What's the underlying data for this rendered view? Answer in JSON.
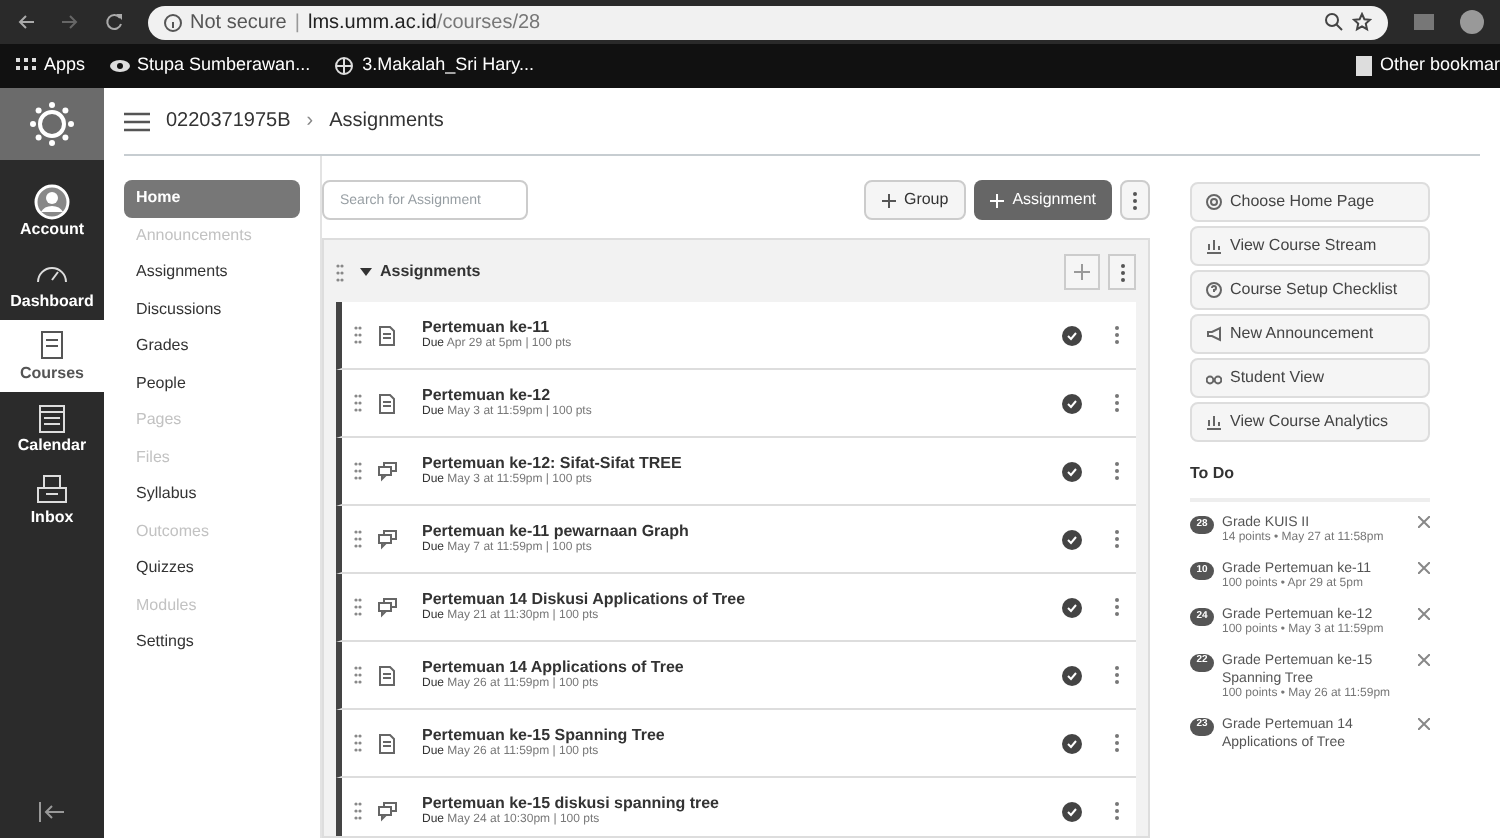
{
  "browser": {
    "security": "Not secure",
    "divider": "|",
    "url_host": "lms.umm.ac.id",
    "url_path": "/courses/28",
    "bookmarks": [
      {
        "label": "Apps",
        "kind": "apps"
      },
      {
        "label": "Stupa Sumberawan...",
        "kind": "eye"
      },
      {
        "label": "3.Makalah_Sri Hary...",
        "kind": "globe"
      }
    ],
    "other_bookmarks": "Other bookmar"
  },
  "global_nav": [
    {
      "label": "Account",
      "kind": "account",
      "selected": false
    },
    {
      "label": "Dashboard",
      "kind": "dashboard",
      "selected": false
    },
    {
      "label": "Courses",
      "kind": "courses",
      "selected": true
    },
    {
      "label": "Calendar",
      "kind": "calendar",
      "selected": false
    },
    {
      "label": "Inbox",
      "kind": "inbox",
      "selected": false
    }
  ],
  "breadcrumb": [
    "0220371975B",
    "Assignments"
  ],
  "breadcrumb_separator": "›",
  "course_nav": [
    {
      "label": "Home",
      "selected": true,
      "disabled": false
    },
    {
      "label": "Announcements",
      "selected": false,
      "disabled": true
    },
    {
      "label": "Assignments",
      "selected": false,
      "disabled": false
    },
    {
      "label": "Discussions",
      "selected": false,
      "disabled": false
    },
    {
      "label": "Grades",
      "selected": false,
      "disabled": false
    },
    {
      "label": "People",
      "selected": false,
      "disabled": false
    },
    {
      "label": "Pages",
      "selected": false,
      "disabled": true
    },
    {
      "label": "Files",
      "selected": false,
      "disabled": true
    },
    {
      "label": "Syllabus",
      "selected": false,
      "disabled": false
    },
    {
      "label": "Outcomes",
      "selected": false,
      "disabled": true
    },
    {
      "label": "Quizzes",
      "selected": false,
      "disabled": false
    },
    {
      "label": "Modules",
      "selected": false,
      "disabled": true
    },
    {
      "label": "Settings",
      "selected": false,
      "disabled": false
    }
  ],
  "search": {
    "placeholder": "Search for Assignment"
  },
  "toolbar": {
    "group_button": "Group",
    "assignment_button": "Assignment"
  },
  "group": {
    "title": "Assignments",
    "expanded": true,
    "rows": [
      {
        "title": "Pertemuan ke-11",
        "kind": "assignment",
        "due_label": "Due",
        "due": "Apr 29 at 5pm",
        "points": "| 100 pts",
        "published": true
      },
      {
        "title": "Pertemuan ke-12",
        "kind": "assignment",
        "due_label": "Due",
        "due": "May 3 at 11:59pm",
        "points": "| 100 pts",
        "published": true
      },
      {
        "title": "Pertemuan ke-12: Sifat-Sifat TREE",
        "kind": "discussion",
        "due_label": "Due",
        "due": "May 3 at 11:59pm",
        "points": "| 100 pts",
        "published": true
      },
      {
        "title": "Pertemuan ke-11 pewarnaan Graph",
        "kind": "discussion",
        "due_label": "Due",
        "due": "May 7 at 11:59pm",
        "points": "| 100 pts",
        "published": true
      },
      {
        "title": "Pertemuan 14 Diskusi Applications of Tree",
        "kind": "discussion",
        "due_label": "Due",
        "due": "May 21 at 11:30pm",
        "points": "| 100 pts",
        "published": true
      },
      {
        "title": "Pertemuan 14 Applications of Tree",
        "kind": "assignment",
        "due_label": "Due",
        "due": "May 26 at 11:59pm",
        "points": "| 100 pts",
        "published": true
      },
      {
        "title": "Pertemuan ke-15 Spanning Tree",
        "kind": "assignment",
        "due_label": "Due",
        "due": "May 26 at 11:59pm",
        "points": "| 100 pts",
        "published": true
      },
      {
        "title": "Pertemuan ke-15 diskusi spanning tree",
        "kind": "discussion",
        "due_label": "Due",
        "due": "May 24 at 10:30pm",
        "points": "| 100 pts",
        "published": true
      }
    ]
  },
  "sidebar_buttons": [
    {
      "label": "Choose Home Page",
      "kind": "target"
    },
    {
      "label": "View Course Stream",
      "kind": "chart"
    },
    {
      "label": "Course Setup Checklist",
      "kind": "question"
    },
    {
      "label": "New Announcement",
      "kind": "megaphone"
    },
    {
      "label": "Student View",
      "kind": "glasses"
    },
    {
      "label": "View Course Analytics",
      "kind": "chart"
    }
  ],
  "todo": {
    "title": "To Do",
    "items": [
      {
        "count": "28",
        "title": "Grade KUIS II",
        "meta": "14 points • May 27 at 11:58pm"
      },
      {
        "count": "10",
        "title": "Grade Pertemuan ke-11",
        "meta": "100 points • Apr 29 at 5pm"
      },
      {
        "count": "24",
        "title": "Grade Pertemuan ke-12",
        "meta": "100 points • May 3 at 11:59pm"
      },
      {
        "count": "22",
        "title": "Grade Pertemuan ke-15 Spanning Tree",
        "meta": "100 points • May 26 at 11:59pm"
      },
      {
        "count": "23",
        "title": "Grade Pertemuan 14 Applications of Tree"
      }
    ]
  }
}
